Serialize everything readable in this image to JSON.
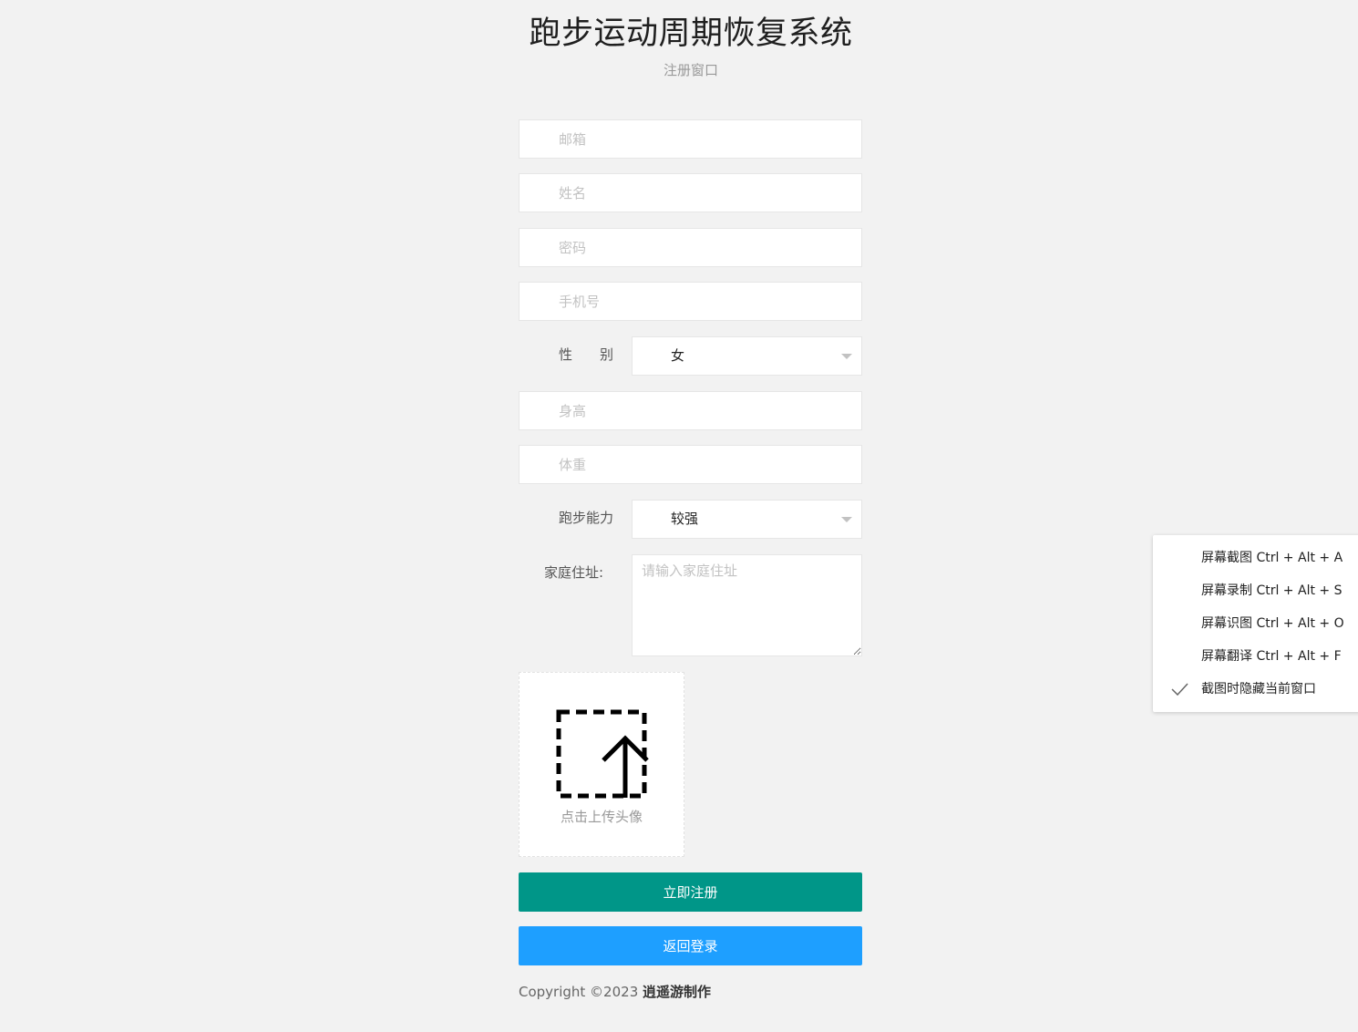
{
  "header": {
    "title": "跑步运动周期恢复系统",
    "subtitle": "注册窗口"
  },
  "form": {
    "email": {
      "placeholder": "邮箱",
      "value": ""
    },
    "name": {
      "placeholder": "姓名",
      "value": ""
    },
    "password": {
      "placeholder": "密码",
      "value": ""
    },
    "phone": {
      "placeholder": "手机号",
      "value": ""
    },
    "gender": {
      "label": "性　　别",
      "value": "女"
    },
    "height": {
      "placeholder": "身高",
      "value": ""
    },
    "weight": {
      "placeholder": "体重",
      "value": ""
    },
    "running_ability": {
      "label": "跑步能力",
      "value": "较强"
    },
    "address": {
      "label": "家庭住址:",
      "placeholder": "请输入家庭住址",
      "value": ""
    },
    "avatar_upload": {
      "label": "点击上传头像"
    },
    "register_button": "立即注册",
    "back_button": "返回登录"
  },
  "footer": {
    "copyright_prefix": "Copyright ©2023 ",
    "author": "逍遥游制作"
  },
  "context_menu": {
    "items": [
      {
        "label": "屏幕截图 Ctrl + Alt + A",
        "checked": false
      },
      {
        "label": "屏幕录制 Ctrl + Alt + S",
        "checked": false
      },
      {
        "label": "屏幕识图 Ctrl + Alt + O",
        "checked": false
      },
      {
        "label": "屏幕翻译 Ctrl + Alt + F",
        "checked": false
      },
      {
        "label": "截图时隐藏当前窗口",
        "checked": true
      }
    ],
    "check_icon": "check-icon"
  },
  "colors": {
    "background": "#f2f2f2",
    "register_button": "#009688",
    "back_button": "#1e9fff",
    "placeholder": "#c2c2c2",
    "border": "#e6e6e6"
  }
}
